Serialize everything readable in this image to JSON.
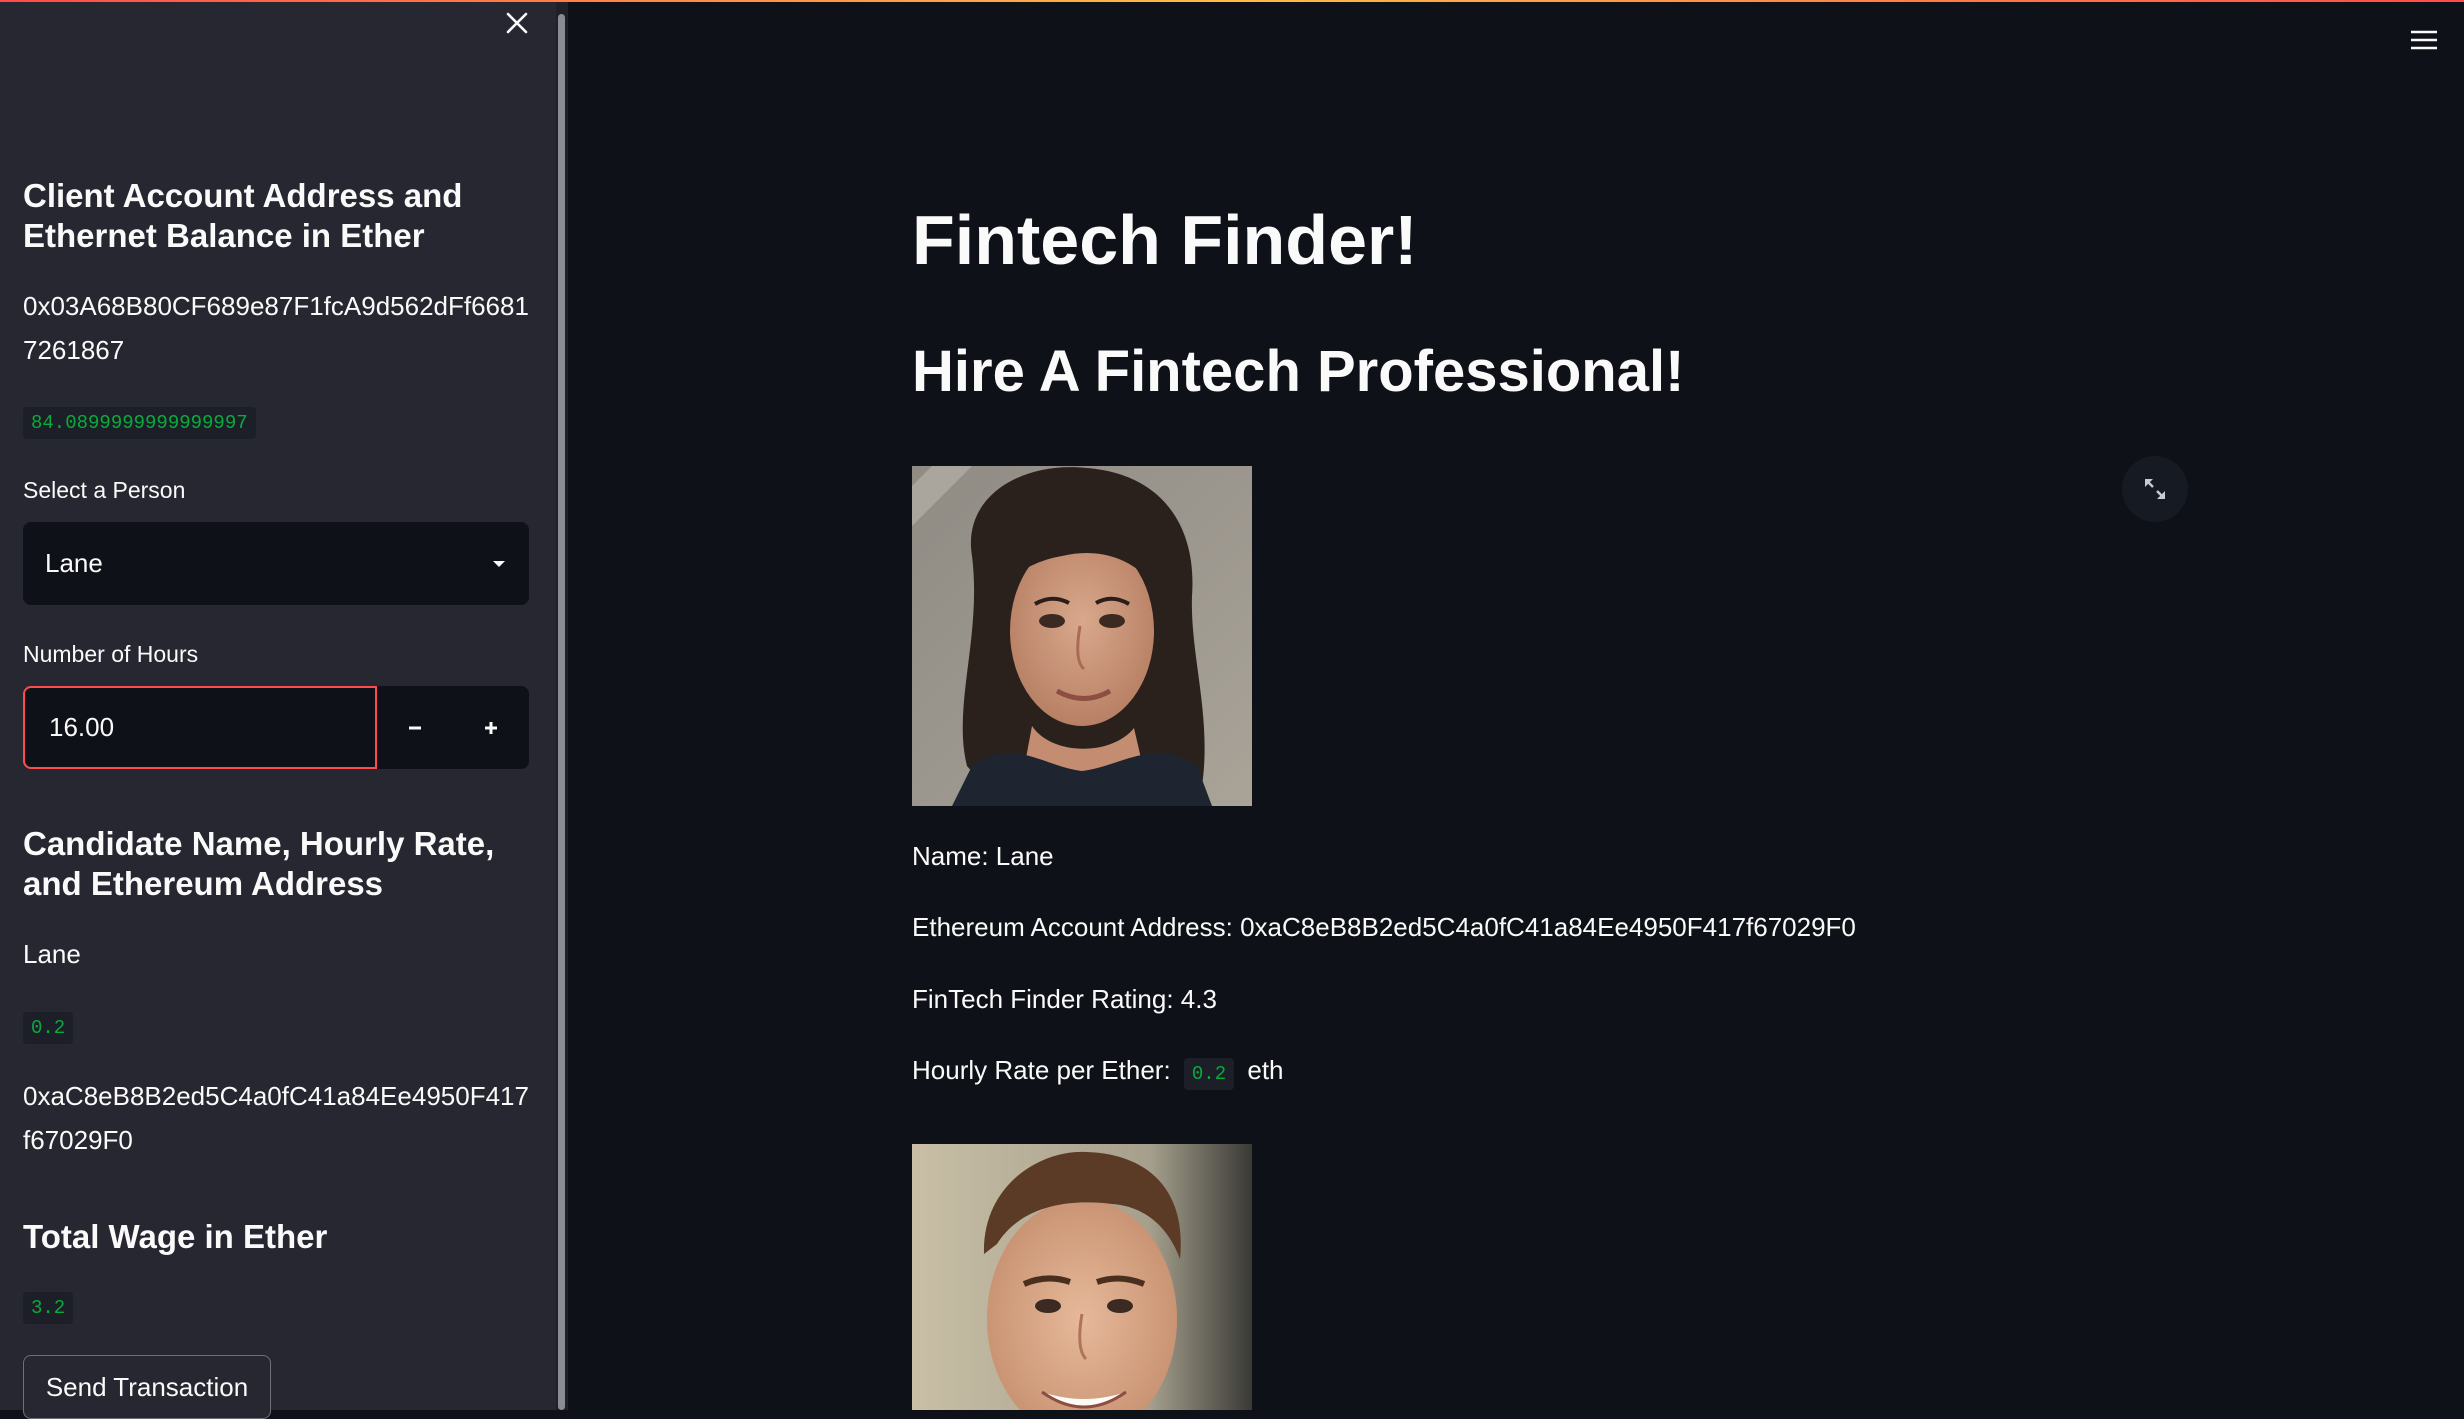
{
  "sidebar": {
    "account_heading": "Client Account Address and Ethernet Balance in Ether",
    "account_address": "0x03A68B80CF689e87F1fcA9d562dFf66817261867",
    "account_balance": "84.0899999999999997",
    "select_label": "Select a Person",
    "select_value": "Lane",
    "hours_label": "Number of Hours",
    "hours_value": "16.00",
    "decrement_symbol": "−",
    "increment_symbol": "+",
    "candidate_heading": "Candidate Name, Hourly Rate, and Ethereum Address",
    "candidate_name": "Lane",
    "candidate_rate": "0.2",
    "candidate_address": "0xaC8eB8B2ed5C4a0fC41a84Ee4950F417f67029F0",
    "wage_heading": "Total Wage in Ether",
    "wage_value": "3.2",
    "send_button": "Send Transaction"
  },
  "main": {
    "title": "Fintech Finder!",
    "subtitle": "Hire A Fintech Professional!",
    "candidates": [
      {
        "name_line": "Name: Lane",
        "address_line": "Ethereum Account Address: 0xaC8eB8B2ed5C4a0fC41a84Ee4950F417f67029F0",
        "rating_line": "FinTech Finder Rating: 4.3",
        "rate_prefix": "Hourly Rate per Ether:",
        "rate_value": "0.2",
        "rate_suffix": "eth"
      }
    ]
  },
  "icons": {
    "close": "close-icon",
    "dropdown": "chevron-down-icon",
    "menu": "hamburger-menu-icon",
    "expand": "fullscreen-expand-icon"
  },
  "colors": {
    "main_bg": "#0e1117",
    "sidebar_bg": "#262730",
    "accent": "#ff4b4b",
    "code_green": "#09ab3b",
    "text": "#fafafa"
  }
}
